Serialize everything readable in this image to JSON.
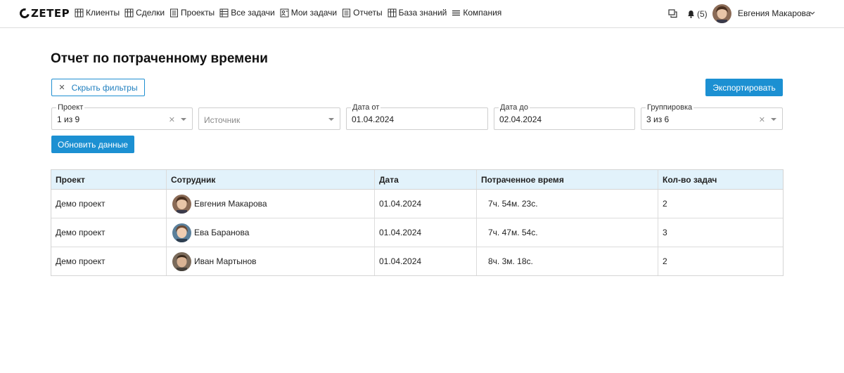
{
  "app": {
    "logo": "ZETEP"
  },
  "nav": [
    {
      "label": "Клиенты",
      "icon": "building-icon"
    },
    {
      "label": "Сделки",
      "icon": "building-icon"
    },
    {
      "label": "Проекты",
      "icon": "document-icon"
    },
    {
      "label": "Все задачи",
      "icon": "list-icon"
    },
    {
      "label": "Мои задачи",
      "icon": "task-user-icon"
    },
    {
      "label": "Отчеты",
      "icon": "document-icon"
    },
    {
      "label": "База знаний",
      "icon": "building-icon"
    },
    {
      "label": "Компания",
      "icon": "menu-lines-icon"
    }
  ],
  "header": {
    "notifications_count": "(5)",
    "user_name": "Евгения Макарова"
  },
  "page": {
    "title": "Отчет по потраченному времени",
    "hide_filters_label": "Скрыть фильтры",
    "export_label": "Экспортировать",
    "refresh_label": "Обновить данные"
  },
  "filters": {
    "project": {
      "label": "Проект",
      "value": "1 из 9"
    },
    "source": {
      "placeholder": "Источник"
    },
    "date_from": {
      "label": "Дата от",
      "value": "01.04.2024"
    },
    "date_to": {
      "label": "Дата до",
      "value": "02.04.2024"
    },
    "grouping": {
      "label": "Группировка",
      "value": "3 из 6"
    }
  },
  "table": {
    "columns": [
      "Проект",
      "Сотрудник",
      "Дата",
      "Потраченное время",
      "Кол-во задач"
    ],
    "rows": [
      {
        "project": "Демо проект",
        "employee": "Евгения Макарова",
        "date": "01.04.2024",
        "time": "7ч. 54м. 23с.",
        "tasks": "2"
      },
      {
        "project": "Демо проект",
        "employee": "Ева Баранова",
        "date": "01.04.2024",
        "time": "7ч. 47м. 54с.",
        "tasks": "3"
      },
      {
        "project": "Демо проект",
        "employee": "Иван Мартынов",
        "date": "01.04.2024",
        "time": "8ч. 3м. 18с.",
        "tasks": "2"
      }
    ]
  },
  "colors": {
    "accent": "#1c90d2",
    "table_header_bg": "#e2f2fb"
  }
}
